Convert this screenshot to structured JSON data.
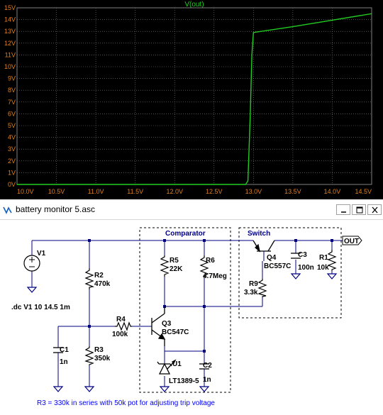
{
  "plot": {
    "trace_label": "V(out)",
    "colors": {
      "background": "#000000",
      "grid": "#808080",
      "frame": "#808080",
      "axis_text": "#e08020",
      "trace": "#22cc22"
    },
    "y_ticks": [
      "0V",
      "1V",
      "2V",
      "3V",
      "4V",
      "5V",
      "6V",
      "7V",
      "8V",
      "9V",
      "10V",
      "11V",
      "12V",
      "13V",
      "14V",
      "15V"
    ],
    "x_ticks": [
      "10.0V",
      "10.5V",
      "11.0V",
      "11.5V",
      "12.0V",
      "12.5V",
      "13.0V",
      "13.5V",
      "14.0V",
      "14.5V"
    ]
  },
  "chart_data": {
    "type": "line",
    "title": "V(out)",
    "xlim": [
      10.0,
      14.5
    ],
    "ylim": [
      0,
      15
    ],
    "grid": true,
    "series": [
      {
        "name": "V(out)",
        "x": [
          10.0,
          12.9,
          12.93,
          12.96,
          12.98,
          13.0,
          13.5,
          14.0,
          14.5
        ],
        "y": [
          0,
          0,
          0.3,
          6.0,
          11.0,
          12.9,
          13.4,
          13.95,
          14.5
        ]
      }
    ]
  },
  "window": {
    "title": "battery monitor 5.asc",
    "buttons": {
      "minimize": "minimize-icon",
      "maximize": "maximize-icon",
      "close": "close-icon"
    }
  },
  "schematic": {
    "colors": {
      "wire": "#000080",
      "component": "#000000",
      "label": "#000000",
      "note": "#0000ff",
      "box_label": "#000080",
      "box": "#000000"
    },
    "boxes": {
      "comparator": "Comparator",
      "switch": "Switch"
    },
    "output_label": "OUT",
    "components": {
      "V1": {
        "name": "V1"
      },
      "R2": {
        "name": "R2",
        "value": "470k"
      },
      "R3": {
        "name": "R3",
        "value": "350k"
      },
      "R4": {
        "name": "R4",
        "value": "100k"
      },
      "R5": {
        "name": "R5",
        "value": "22K"
      },
      "R6": {
        "name": "R6",
        "value": "4.7Meg"
      },
      "Q3": {
        "name": "Q3",
        "value": "BC547C"
      },
      "Q4": {
        "name": "Q4",
        "value": "BC557C"
      },
      "R9": {
        "name": "R9",
        "value": "3.3k"
      },
      "C1": {
        "name": "C1",
        "value": "1n"
      },
      "C2": {
        "name": "C2",
        "value": "1n"
      },
      "C3": {
        "name": "C3",
        "value": "100n"
      },
      "R1": {
        "name": "R1",
        "value": "10k"
      },
      "U1": {
        "name": "U1",
        "value": "LT1389-5"
      }
    },
    "directive": ".dc V1 10 14.5 1m",
    "note": "R3 = 330k in series with 50k pot for adjusting trip voltage"
  }
}
